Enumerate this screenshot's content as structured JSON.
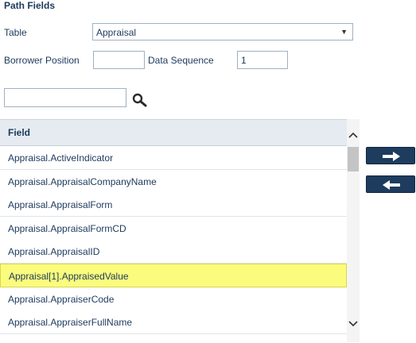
{
  "section": {
    "title": "Path Fields"
  },
  "table": {
    "label": "Table",
    "value": "Appraisal"
  },
  "borrower_position": {
    "label": "Borrower Position",
    "value": ""
  },
  "data_sequence": {
    "label": "Data Sequence",
    "value": "1"
  },
  "search": {
    "value": "",
    "icon": "magnifier-icon"
  },
  "grid": {
    "header": "Field",
    "rows": [
      "Appraisal.ActiveIndicator",
      "Appraisal.AppraisalCompanyName",
      "Appraisal.AppraisalForm",
      "Appraisal.AppraisalFormCD",
      "Appraisal.AppraisalID",
      "Appraisal[1].AppraisedValue",
      "Appraisal.AppraiserCode",
      "Appraisal.AppraiserFullName"
    ],
    "selected_index": 5
  },
  "buttons": {
    "add": "arrow-right-icon",
    "remove": "arrow-left-icon"
  },
  "colors": {
    "selected_row": "#fbfb7d",
    "button_bg": "#1e3c5e",
    "text": "#1b3a5c"
  }
}
